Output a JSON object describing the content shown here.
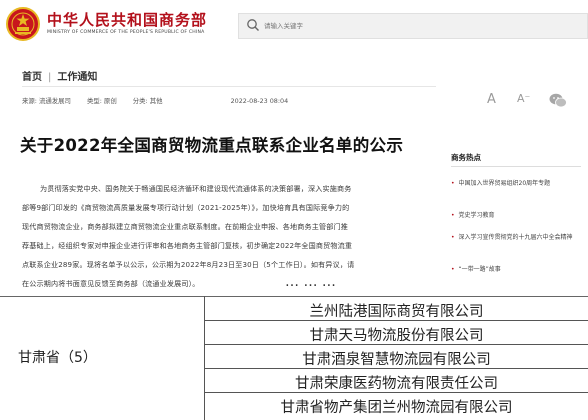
{
  "header": {
    "site_name_cn": "中华人民共和国商务部",
    "site_name_en": "MINISTRY OF COMMERCE OF THE PEOPLE'S REPUBLIC OF CHINA",
    "search_placeholder": "请输入关键字"
  },
  "breadcrumb": [
    "首页",
    "工作通知"
  ],
  "meta": {
    "source": "来源: 流通发展司",
    "category": "类型: 原创",
    "sort": "分类: 其他",
    "date": "2022-08-23 08:04"
  },
  "tools": {
    "font_large": "A",
    "font_small": "A⁻"
  },
  "article": {
    "title": "关于2022年全国商贸物流重点联系企业名单的公示",
    "body_lines": [
      "为贯彻落实党中央、国务院关于畅通国民经济循环和建设现代流通体系的决策部署，深入实施商务",
      "部等9部门印发的《商贸物流高质量发展专项行动计划（2021-2025年）》，加快培育具有国际竞争力的",
      "现代商贸物流企业，商务部拟建立商贸物流企业重点联系制度。在前期企业申报、各地商务主管部门推",
      "荐基础上，经组织专家对申报企业进行评审和各地商务主管部门复核，初步确定2022年全国商贸物流重",
      "点联系企业289家。现将名单予以公示，公示期为2022年8月23日至30日（5个工作日）。如有异议，请",
      "在公示期内将书面意见反馈至商务部（流通业发展司）。"
    ]
  },
  "sidebar": {
    "title": "商务热点",
    "items": [
      "中国加入世界贸易组织20周年专题",
      "党史学习教育",
      "深入学习宣传贯彻党的十九届六中全会精神",
      "“一带一路”故事"
    ]
  },
  "table": {
    "cut_row_text": "… … …",
    "province": "甘肃省（5）",
    "companies": [
      "兰州陆港国际商贸有限公司",
      "甘肃天马物流股份有限公司",
      "甘肃酒泉智慧物流园有限公司",
      "甘肃荣康医药物流有限责任公司",
      "甘肃省物产集团兰州物流园有限公司"
    ]
  },
  "colors": {
    "brand_red": "#b3101b",
    "emblem_gold": "#e8b923"
  }
}
